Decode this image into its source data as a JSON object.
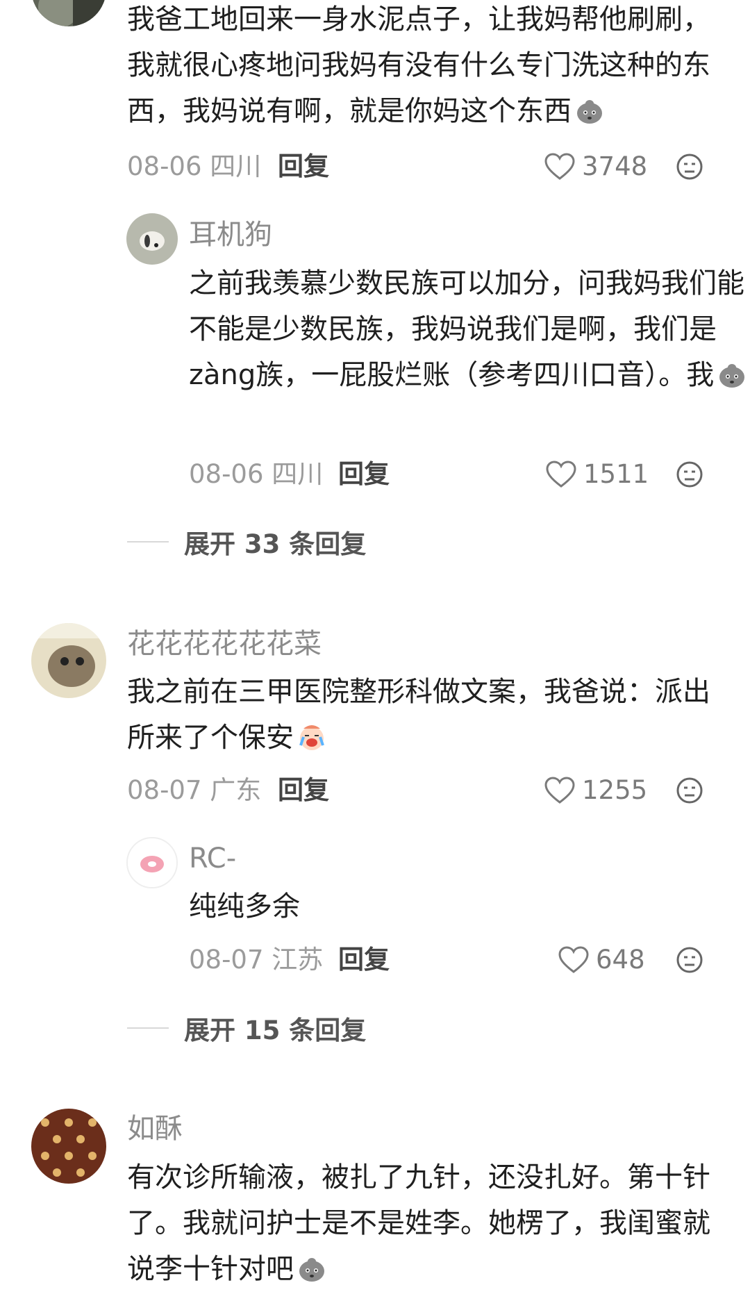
{
  "comments": [
    {
      "text": "我爸工地回来一身水泥点子，让我妈帮他刷刷，我就很心疼地问我妈有没有什么专门洗这种的东西，我妈说有啊，就是你妈这个东西",
      "emoji": "gray-blob-emoji",
      "date": "08-06 四川",
      "reply_label": "回复",
      "likes": "3748",
      "replies": [
        {
          "username": "耳机狗",
          "text": "之前我羡慕少数民族可以加分，问我妈我们能不能是少数民族，我妈说我们是啊，我们是zàng族，一屁股烂账（参考四川口音）。我",
          "emoji": "gray-blob-emoji",
          "date": "08-06 四川",
          "reply_label": "回复",
          "likes": "1511"
        }
      ],
      "expand_label": "展开 33 条回复"
    },
    {
      "username": "花花花花花花菜",
      "text": "我之前在三甲医院整形科做文案，我爸说：派出所来了个保安",
      "emoji": "crying-baby-emoji",
      "date": "08-07 广东",
      "reply_label": "回复",
      "likes": "1255",
      "replies": [
        {
          "username": "RC-",
          "text": "纯纯多余",
          "date": "08-07 江苏",
          "reply_label": "回复",
          "likes": "648"
        }
      ],
      "expand_label": "展开 15 条回复"
    },
    {
      "username": "如酥",
      "text": "有次诊所输液，被扎了九针，还没扎好。第十针了。我就问护士是不是姓李。她楞了，我闺蜜就说李十针对吧",
      "emoji": "gray-blob-emoji"
    }
  ],
  "icons": {
    "like": "heart-outline-icon",
    "dislike": "neutral-face-icon"
  },
  "colors": {
    "username": "#8b8b8b",
    "body": "#1f1f1f",
    "meta": "#9b9b9b"
  }
}
